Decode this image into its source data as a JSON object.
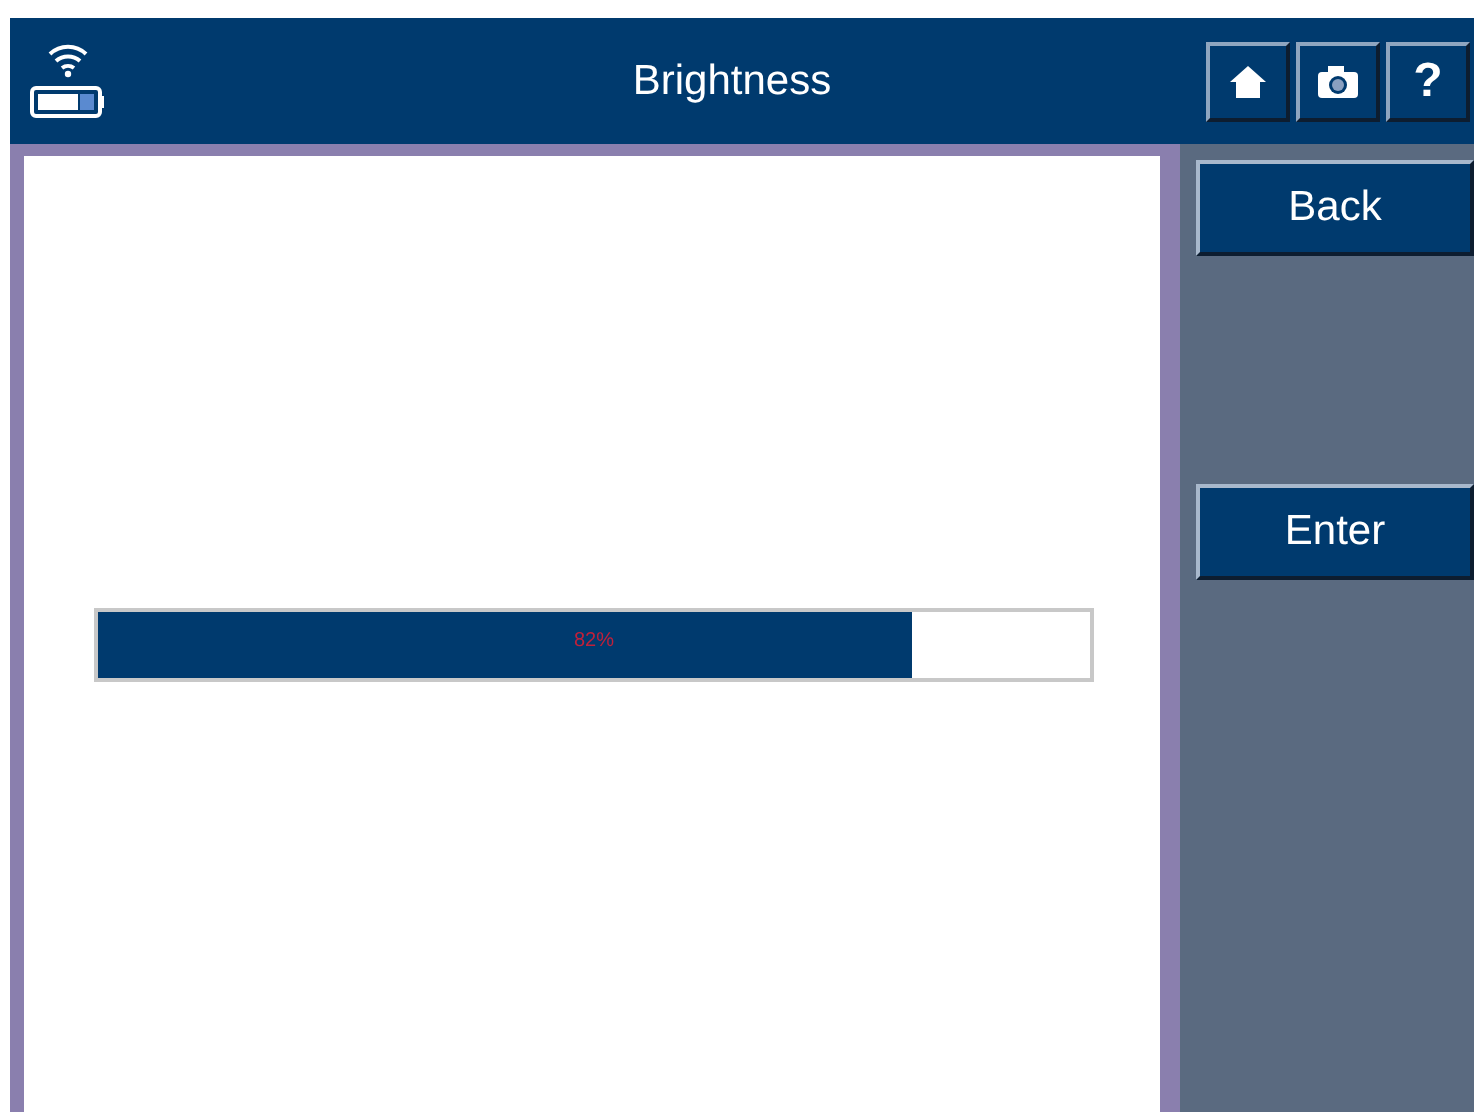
{
  "window": {
    "title": "Brightness"
  },
  "toolbar": [
    {
      "kind": "home"
    },
    {
      "kind": "camera"
    },
    {
      "kind": "help",
      "label": "?"
    }
  ],
  "brightness": {
    "level": 0.82,
    "reading": "82%"
  },
  "buttons": [
    "Back",
    "Enter"
  ]
}
